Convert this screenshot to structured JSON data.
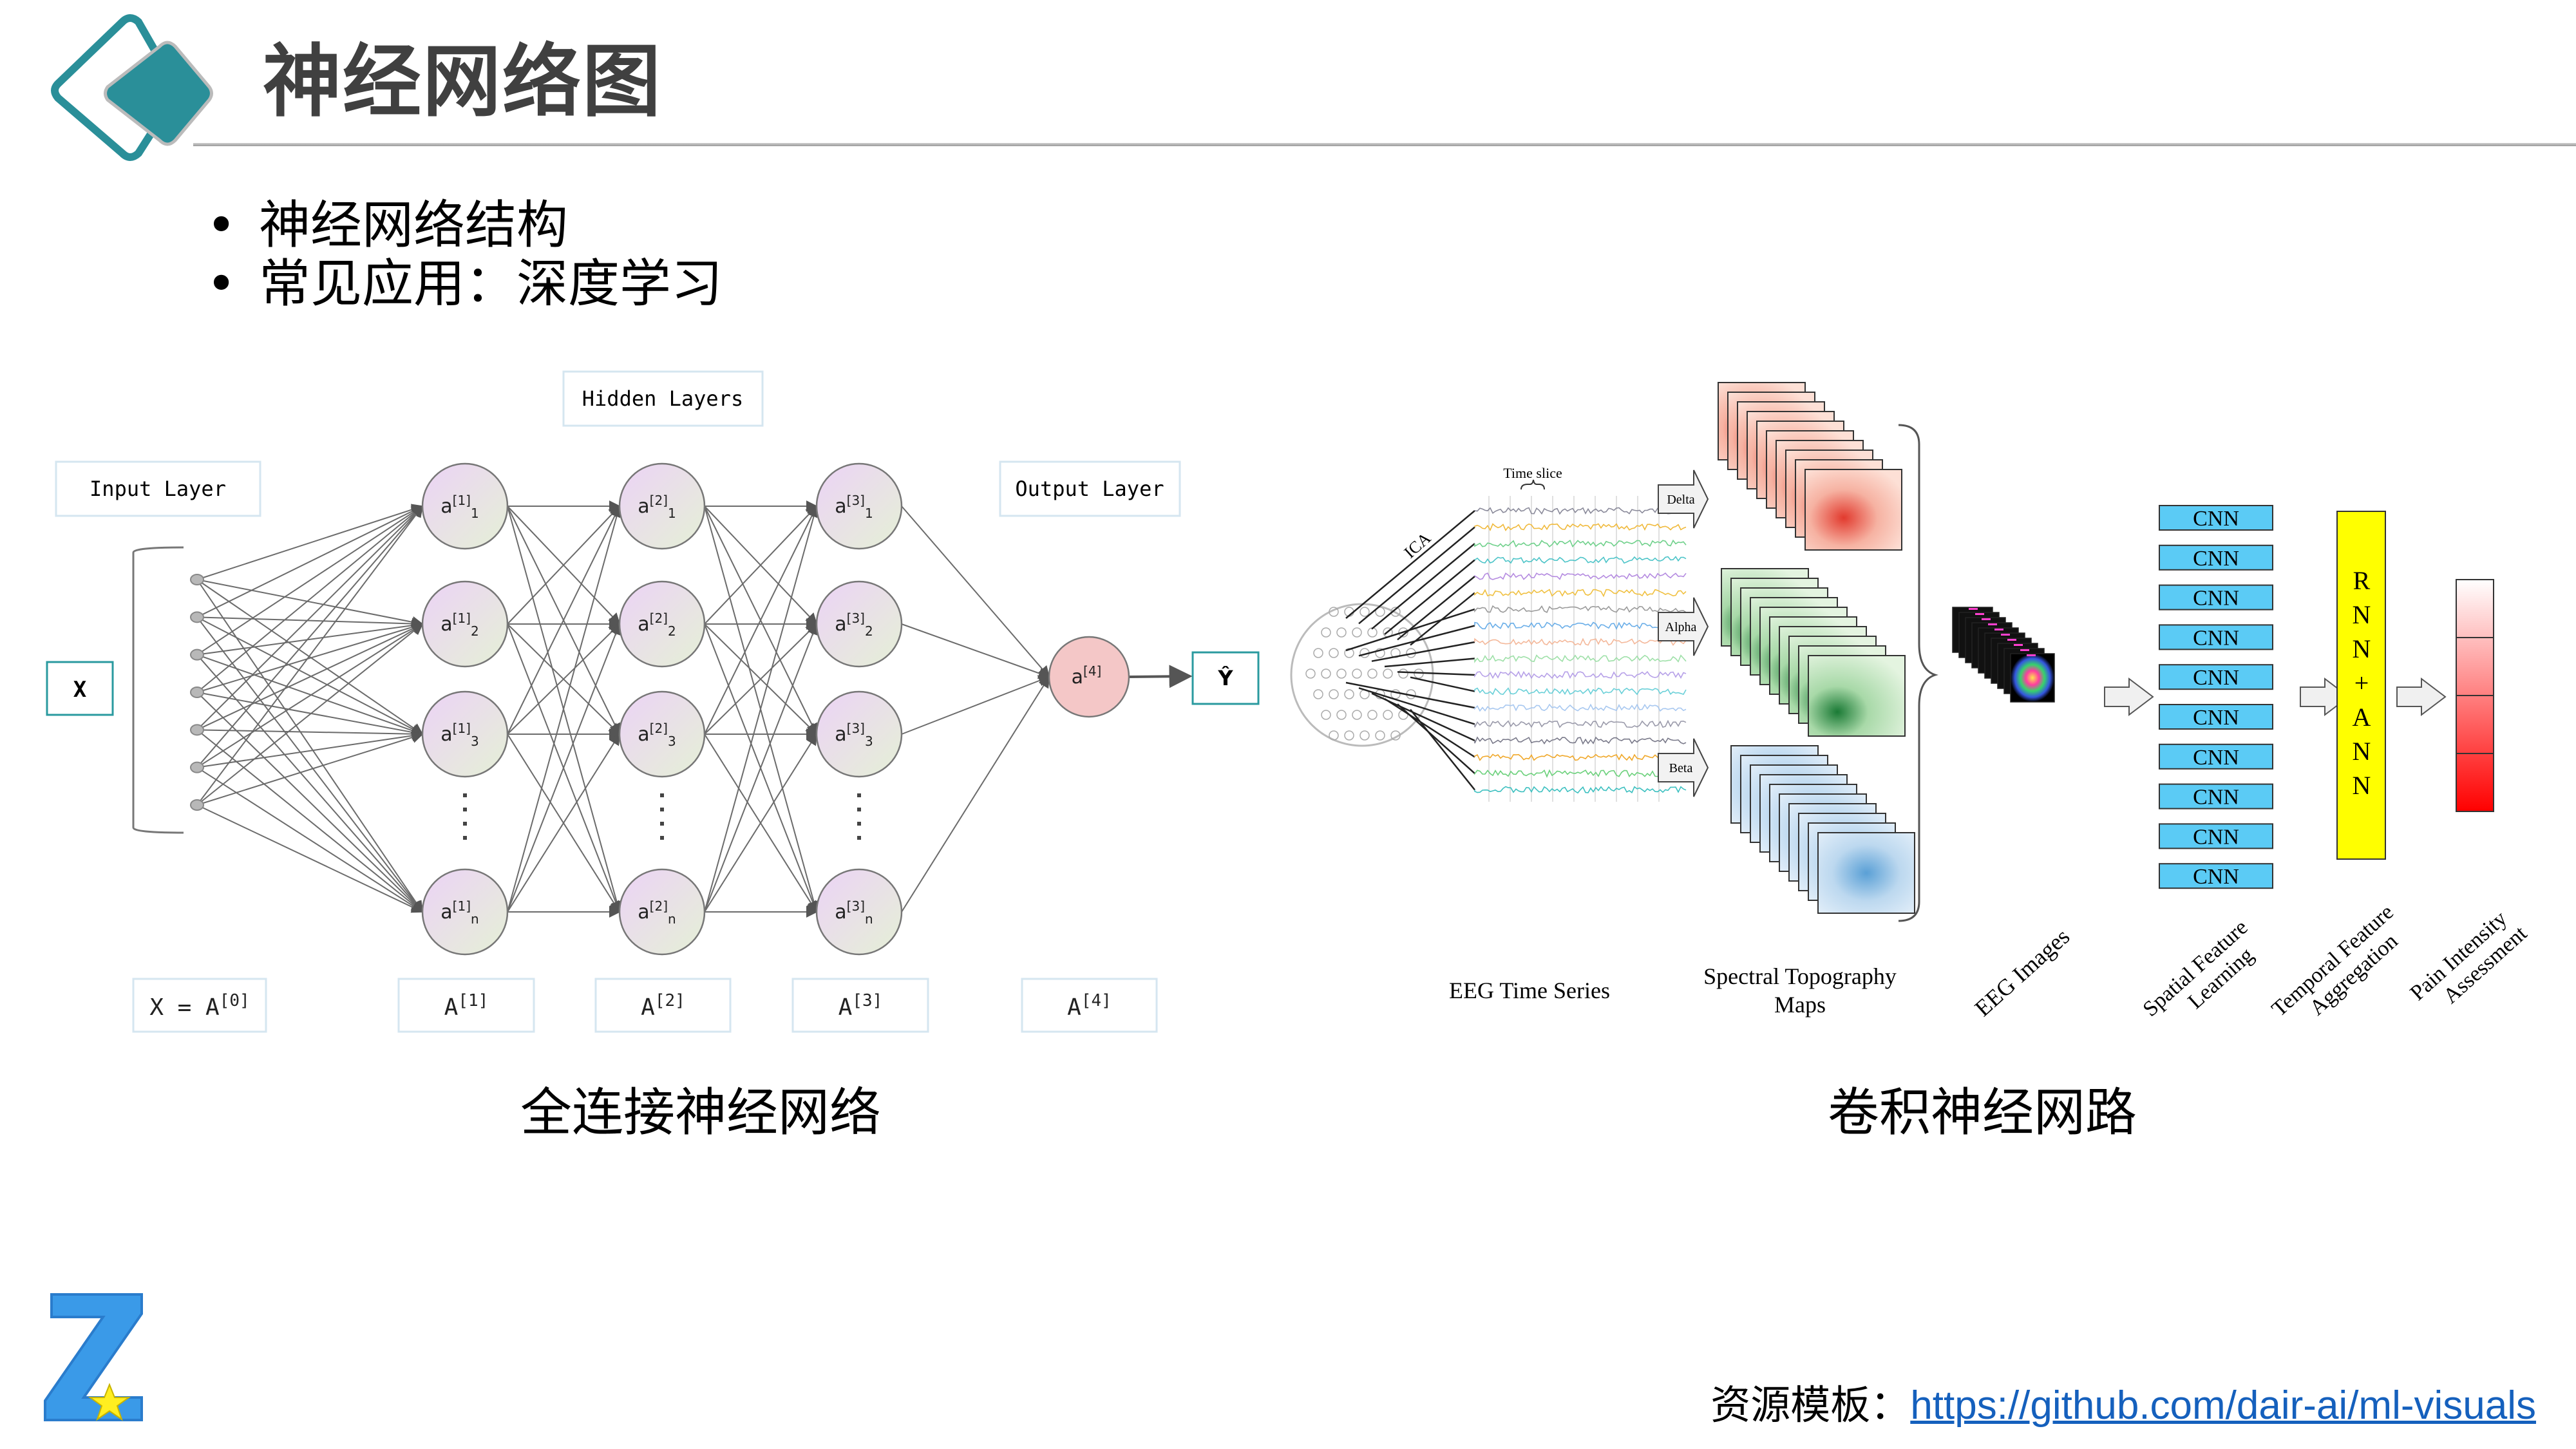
{
  "slide": {
    "title": "神经网络图",
    "bullets": [
      "神经网络结构",
      "常见应用：深度学习"
    ],
    "bullet_glyph": "•"
  },
  "fc_network": {
    "caption": "全连接神经网络",
    "labels": {
      "hidden_layers": "Hidden Layers",
      "input_layer": "Input Layer",
      "output_layer": "Output Layer",
      "x": "X",
      "y_hat": "Ŷ"
    },
    "layer1_nodes": [
      {
        "base": "a",
        "sup": "[1]",
        "sub": "1"
      },
      {
        "base": "a",
        "sup": "[1]",
        "sub": "2"
      },
      {
        "base": "a",
        "sup": "[1]",
        "sub": "3"
      },
      {
        "base": "a",
        "sup": "[1]",
        "sub": "n"
      }
    ],
    "layer2_nodes": [
      {
        "base": "a",
        "sup": "[2]",
        "sub": "1"
      },
      {
        "base": "a",
        "sup": "[2]",
        "sub": "2"
      },
      {
        "base": "a",
        "sup": "[2]",
        "sub": "3"
      },
      {
        "base": "a",
        "sup": "[2]",
        "sub": "n"
      }
    ],
    "layer3_nodes": [
      {
        "base": "a",
        "sup": "[3]",
        "sub": "1"
      },
      {
        "base": "a",
        "sup": "[3]",
        "sub": "2"
      },
      {
        "base": "a",
        "sup": "[3]",
        "sub": "3"
      },
      {
        "base": "a",
        "sup": "[3]",
        "sub": "n"
      }
    ],
    "output_node": {
      "base": "a",
      "sup": "[4]"
    },
    "input_dot_count": 7,
    "ellipsis": "⋮",
    "activation_labels": [
      {
        "base": "X = A",
        "sup": "[0]"
      },
      {
        "base": "A",
        "sup": "[1]"
      },
      {
        "base": "A",
        "sup": "[2]"
      },
      {
        "base": "A",
        "sup": "[3]"
      },
      {
        "base": "A",
        "sup": "[4]"
      }
    ],
    "colors": {
      "hidden_node_top": "#ead6f2",
      "hidden_node_bottom": "#e6efd9",
      "output_node": "#f4c7c7",
      "io_box_border": "#2a9a9f",
      "label_box_border": "#d5e6f0",
      "edge": "#6b6b6b"
    }
  },
  "cnn_pipeline": {
    "caption": "卷积神经网路",
    "time_slice_label": "Time slice",
    "ica_label": "ICA",
    "bands": [
      "Delta",
      "Alpha",
      "Beta"
    ],
    "stage_labels": {
      "eeg_time_series": "EEG Time Series",
      "spectral_maps": [
        "Spectral Topography",
        "Maps"
      ],
      "eeg_images": "EEG Images",
      "spatial": [
        "Spatial Feature",
        "Learning"
      ],
      "temporal": [
        "Temporal Feature",
        "Aggregation"
      ],
      "pain": [
        "Pain Intensity",
        "Assessment"
      ]
    },
    "cnn_blocks": [
      "CNN",
      "CNN",
      "CNN",
      "CNN",
      "CNN",
      "CNN",
      "CNN",
      "CNN",
      "CNN",
      "CNN"
    ],
    "rnn_ann_letters": [
      "R",
      "N",
      "N",
      "+",
      "A",
      "N",
      "N"
    ],
    "colors": {
      "cnn_block": "#5bcbf5",
      "rnn_block": "#ffff00",
      "delta": "#e0413a",
      "alpha": "#1e8a3c",
      "beta": "#4b94cc",
      "pain_bar_top": "#ffffff",
      "pain_bar_bottom": "#ff0000"
    }
  },
  "footer": {
    "source_label": "资源模板：",
    "link_text": "https://github.com/dair-ai/ml-visuals"
  },
  "brand": {
    "accent": "#2a8f99",
    "logo_letter": "Z"
  }
}
